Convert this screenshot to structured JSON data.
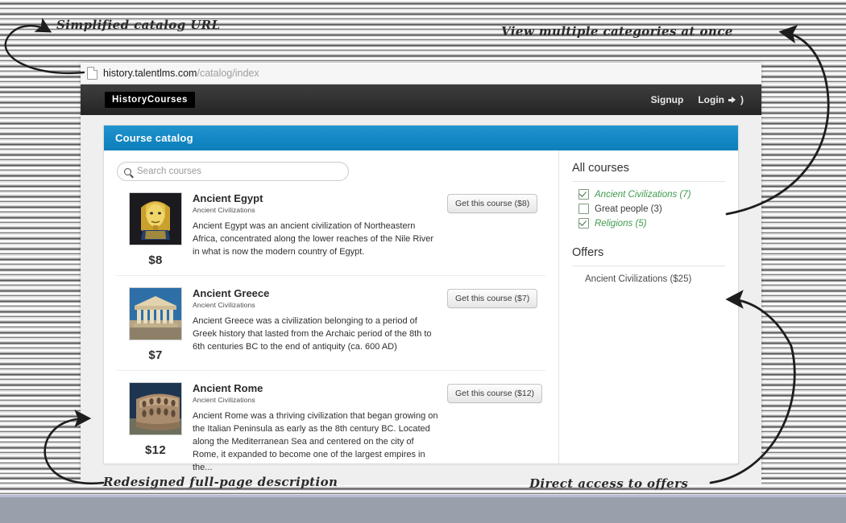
{
  "browser": {
    "url_domain": "history.talentlms.com",
    "url_path": "/catalog/index",
    "page_icon": "document-icon"
  },
  "site_header": {
    "logo": "HistoryCourses",
    "nav": [
      {
        "label": "Signup",
        "icon": null
      },
      {
        "label": "Login",
        "icon": "sign-in-icon"
      }
    ]
  },
  "panel": {
    "title": "Course catalog"
  },
  "search": {
    "placeholder": "Search courses",
    "value": "",
    "icon": "search-icon"
  },
  "courses": [
    {
      "title": "Ancient Egypt",
      "category": "Ancient Civilizations",
      "description": "Ancient Egypt was an ancient civilization of Northeastern Africa, concentrated along the lower reaches of the Nile River in what is now the modern country of Egypt.",
      "price": "$8",
      "button": "Get this course ($8)",
      "thumb_alt": "tutankhamun-mask-thumbnail"
    },
    {
      "title": "Ancient Greece",
      "category": "Ancient Civilizations",
      "description": "Ancient Greece was a civilization belonging to a period of Greek history that lasted from the Archaic period of the 8th to 6th centuries BC to the end of antiquity (ca. 600 AD)",
      "price": "$7",
      "button": "Get this course ($7)",
      "thumb_alt": "parthenon-thumbnail"
    },
    {
      "title": "Ancient Rome",
      "category": "Ancient Civilizations",
      "description": "Ancient Rome was a thriving civilization that began growing on the Italian Peninsula as early as the 8th century BC. Located along the Mediterranean Sea and centered on the city of Rome, it expanded to become one of the largest empires in the...",
      "price": "$12",
      "button": "Get this course ($12)",
      "thumb_alt": "colosseum-thumbnail"
    }
  ],
  "sidebar": {
    "all_courses_heading": "All courses",
    "categories": [
      {
        "label": "Ancient Civilizations (7)",
        "checked": true
      },
      {
        "label": "Great people (3)",
        "checked": false
      },
      {
        "label": "Religions (5)",
        "checked": true
      }
    ],
    "offers_heading": "Offers",
    "offers": [
      {
        "label": "Ancient Civilizations ($25)"
      }
    ]
  },
  "annotations": [
    {
      "text": "Simplified catalog URL"
    },
    {
      "text": "View multiple categories at once"
    },
    {
      "text": "Redesigned full-page description"
    },
    {
      "text": "Direct access to offers"
    }
  ],
  "colors": {
    "panel_header_blue": "#1287c4",
    "site_header_dark": "#333333",
    "category_checked_green": "#3f9a4e",
    "bottom_band_gray": "#9aa0ab"
  }
}
